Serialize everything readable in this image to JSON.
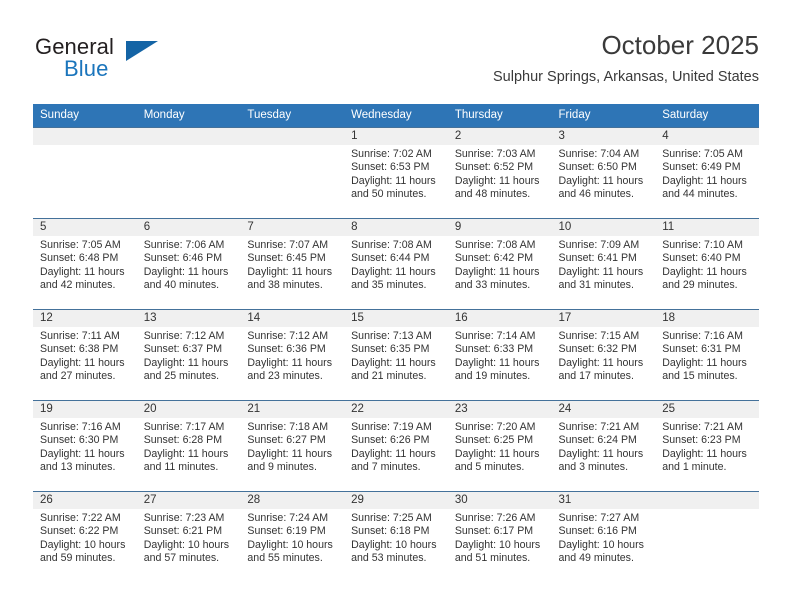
{
  "brand": {
    "name_top": "General",
    "name_bottom": "Blue",
    "triangle_icon": "brand-triangle-icon",
    "color_dark": "#231f20",
    "color_blue": "#1b75bc"
  },
  "header": {
    "title": "October 2025",
    "subtitle": "Sulphur Springs, Arkansas, United States"
  },
  "theme": {
    "header_bg": "#2e75b6",
    "header_text": "#ffffff",
    "daynum_band_bg": "#f0f0f0",
    "row_rule": "#44719a",
    "body_text": "#333333"
  },
  "calendar": {
    "weekday_headers": [
      "Sunday",
      "Monday",
      "Tuesday",
      "Wednesday",
      "Thursday",
      "Friday",
      "Saturday"
    ],
    "weeks": [
      [
        {
          "day": "",
          "sunrise": "",
          "sunset": "",
          "daylight_line1": "",
          "daylight_line2": ""
        },
        {
          "day": "",
          "sunrise": "",
          "sunset": "",
          "daylight_line1": "",
          "daylight_line2": ""
        },
        {
          "day": "",
          "sunrise": "",
          "sunset": "",
          "daylight_line1": "",
          "daylight_line2": ""
        },
        {
          "day": "1",
          "sunrise": "Sunrise: 7:02 AM",
          "sunset": "Sunset: 6:53 PM",
          "daylight_line1": "Daylight: 11 hours",
          "daylight_line2": "and 50 minutes."
        },
        {
          "day": "2",
          "sunrise": "Sunrise: 7:03 AM",
          "sunset": "Sunset: 6:52 PM",
          "daylight_line1": "Daylight: 11 hours",
          "daylight_line2": "and 48 minutes."
        },
        {
          "day": "3",
          "sunrise": "Sunrise: 7:04 AM",
          "sunset": "Sunset: 6:50 PM",
          "daylight_line1": "Daylight: 11 hours",
          "daylight_line2": "and 46 minutes."
        },
        {
          "day": "4",
          "sunrise": "Sunrise: 7:05 AM",
          "sunset": "Sunset: 6:49 PM",
          "daylight_line1": "Daylight: 11 hours",
          "daylight_line2": "and 44 minutes."
        }
      ],
      [
        {
          "day": "5",
          "sunrise": "Sunrise: 7:05 AM",
          "sunset": "Sunset: 6:48 PM",
          "daylight_line1": "Daylight: 11 hours",
          "daylight_line2": "and 42 minutes."
        },
        {
          "day": "6",
          "sunrise": "Sunrise: 7:06 AM",
          "sunset": "Sunset: 6:46 PM",
          "daylight_line1": "Daylight: 11 hours",
          "daylight_line2": "and 40 minutes."
        },
        {
          "day": "7",
          "sunrise": "Sunrise: 7:07 AM",
          "sunset": "Sunset: 6:45 PM",
          "daylight_line1": "Daylight: 11 hours",
          "daylight_line2": "and 38 minutes."
        },
        {
          "day": "8",
          "sunrise": "Sunrise: 7:08 AM",
          "sunset": "Sunset: 6:44 PM",
          "daylight_line1": "Daylight: 11 hours",
          "daylight_line2": "and 35 minutes."
        },
        {
          "day": "9",
          "sunrise": "Sunrise: 7:08 AM",
          "sunset": "Sunset: 6:42 PM",
          "daylight_line1": "Daylight: 11 hours",
          "daylight_line2": "and 33 minutes."
        },
        {
          "day": "10",
          "sunrise": "Sunrise: 7:09 AM",
          "sunset": "Sunset: 6:41 PM",
          "daylight_line1": "Daylight: 11 hours",
          "daylight_line2": "and 31 minutes."
        },
        {
          "day": "11",
          "sunrise": "Sunrise: 7:10 AM",
          "sunset": "Sunset: 6:40 PM",
          "daylight_line1": "Daylight: 11 hours",
          "daylight_line2": "and 29 minutes."
        }
      ],
      [
        {
          "day": "12",
          "sunrise": "Sunrise: 7:11 AM",
          "sunset": "Sunset: 6:38 PM",
          "daylight_line1": "Daylight: 11 hours",
          "daylight_line2": "and 27 minutes."
        },
        {
          "day": "13",
          "sunrise": "Sunrise: 7:12 AM",
          "sunset": "Sunset: 6:37 PM",
          "daylight_line1": "Daylight: 11 hours",
          "daylight_line2": "and 25 minutes."
        },
        {
          "day": "14",
          "sunrise": "Sunrise: 7:12 AM",
          "sunset": "Sunset: 6:36 PM",
          "daylight_line1": "Daylight: 11 hours",
          "daylight_line2": "and 23 minutes."
        },
        {
          "day": "15",
          "sunrise": "Sunrise: 7:13 AM",
          "sunset": "Sunset: 6:35 PM",
          "daylight_line1": "Daylight: 11 hours",
          "daylight_line2": "and 21 minutes."
        },
        {
          "day": "16",
          "sunrise": "Sunrise: 7:14 AM",
          "sunset": "Sunset: 6:33 PM",
          "daylight_line1": "Daylight: 11 hours",
          "daylight_line2": "and 19 minutes."
        },
        {
          "day": "17",
          "sunrise": "Sunrise: 7:15 AM",
          "sunset": "Sunset: 6:32 PM",
          "daylight_line1": "Daylight: 11 hours",
          "daylight_line2": "and 17 minutes."
        },
        {
          "day": "18",
          "sunrise": "Sunrise: 7:16 AM",
          "sunset": "Sunset: 6:31 PM",
          "daylight_line1": "Daylight: 11 hours",
          "daylight_line2": "and 15 minutes."
        }
      ],
      [
        {
          "day": "19",
          "sunrise": "Sunrise: 7:16 AM",
          "sunset": "Sunset: 6:30 PM",
          "daylight_line1": "Daylight: 11 hours",
          "daylight_line2": "and 13 minutes."
        },
        {
          "day": "20",
          "sunrise": "Sunrise: 7:17 AM",
          "sunset": "Sunset: 6:28 PM",
          "daylight_line1": "Daylight: 11 hours",
          "daylight_line2": "and 11 minutes."
        },
        {
          "day": "21",
          "sunrise": "Sunrise: 7:18 AM",
          "sunset": "Sunset: 6:27 PM",
          "daylight_line1": "Daylight: 11 hours",
          "daylight_line2": "and 9 minutes."
        },
        {
          "day": "22",
          "sunrise": "Sunrise: 7:19 AM",
          "sunset": "Sunset: 6:26 PM",
          "daylight_line1": "Daylight: 11 hours",
          "daylight_line2": "and 7 minutes."
        },
        {
          "day": "23",
          "sunrise": "Sunrise: 7:20 AM",
          "sunset": "Sunset: 6:25 PM",
          "daylight_line1": "Daylight: 11 hours",
          "daylight_line2": "and 5 minutes."
        },
        {
          "day": "24",
          "sunrise": "Sunrise: 7:21 AM",
          "sunset": "Sunset: 6:24 PM",
          "daylight_line1": "Daylight: 11 hours",
          "daylight_line2": "and 3 minutes."
        },
        {
          "day": "25",
          "sunrise": "Sunrise: 7:21 AM",
          "sunset": "Sunset: 6:23 PM",
          "daylight_line1": "Daylight: 11 hours",
          "daylight_line2": "and 1 minute."
        }
      ],
      [
        {
          "day": "26",
          "sunrise": "Sunrise: 7:22 AM",
          "sunset": "Sunset: 6:22 PM",
          "daylight_line1": "Daylight: 10 hours",
          "daylight_line2": "and 59 minutes."
        },
        {
          "day": "27",
          "sunrise": "Sunrise: 7:23 AM",
          "sunset": "Sunset: 6:21 PM",
          "daylight_line1": "Daylight: 10 hours",
          "daylight_line2": "and 57 minutes."
        },
        {
          "day": "28",
          "sunrise": "Sunrise: 7:24 AM",
          "sunset": "Sunset: 6:19 PM",
          "daylight_line1": "Daylight: 10 hours",
          "daylight_line2": "and 55 minutes."
        },
        {
          "day": "29",
          "sunrise": "Sunrise: 7:25 AM",
          "sunset": "Sunset: 6:18 PM",
          "daylight_line1": "Daylight: 10 hours",
          "daylight_line2": "and 53 minutes."
        },
        {
          "day": "30",
          "sunrise": "Sunrise: 7:26 AM",
          "sunset": "Sunset: 6:17 PM",
          "daylight_line1": "Daylight: 10 hours",
          "daylight_line2": "and 51 minutes."
        },
        {
          "day": "31",
          "sunrise": "Sunrise: 7:27 AM",
          "sunset": "Sunset: 6:16 PM",
          "daylight_line1": "Daylight: 10 hours",
          "daylight_line2": "and 49 minutes."
        },
        {
          "day": "",
          "sunrise": "",
          "sunset": "",
          "daylight_line1": "",
          "daylight_line2": ""
        }
      ]
    ]
  }
}
